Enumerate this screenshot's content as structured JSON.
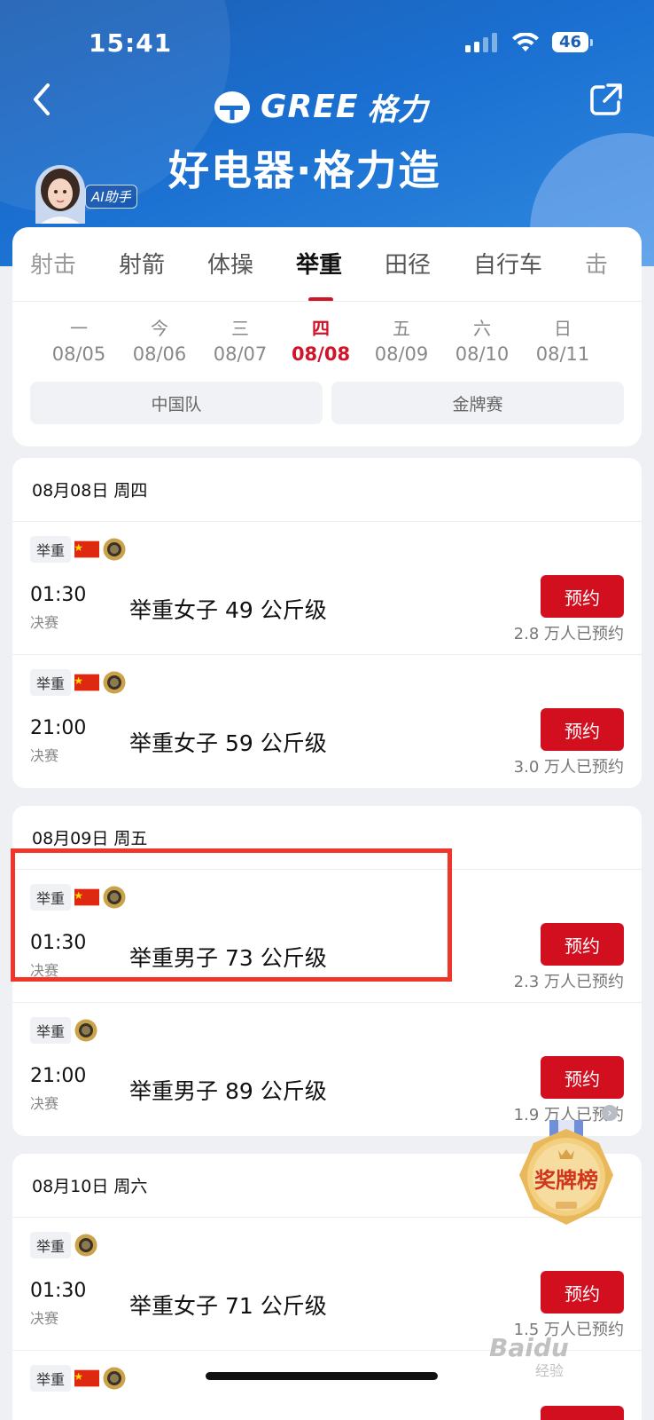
{
  "status_bar": {
    "time": "15:41",
    "battery": "46"
  },
  "header": {
    "brand_name": "GREE",
    "brand_cn": "格力",
    "slogan": "好电器·格力造",
    "ai_badge": "AI助手"
  },
  "sport_tabs": [
    {
      "label": "射击",
      "active": false
    },
    {
      "label": "射箭",
      "active": false
    },
    {
      "label": "体操",
      "active": false
    },
    {
      "label": "举重",
      "active": true
    },
    {
      "label": "田径",
      "active": false
    },
    {
      "label": "自行车",
      "active": false
    },
    {
      "label": "击",
      "active": false
    }
  ],
  "days": [
    {
      "weekday": "一",
      "date": "08/05",
      "active": false
    },
    {
      "weekday": "今",
      "date": "08/06",
      "active": false
    },
    {
      "weekday": "三",
      "date": "08/07",
      "active": false
    },
    {
      "weekday": "四",
      "date": "08/08",
      "active": true
    },
    {
      "weekday": "五",
      "date": "08/09",
      "active": false
    },
    {
      "weekday": "六",
      "date": "08/10",
      "active": false
    },
    {
      "weekday": "日",
      "date": "08/11",
      "active": false
    }
  ],
  "filters": {
    "team": "中国队",
    "gold": "金牌赛"
  },
  "groups": [
    {
      "date": "08月08日 周四",
      "events": [
        {
          "tag": "举重",
          "cn_flag": true,
          "time": "01:30",
          "phase": "决赛",
          "name": "举重女子 49 公斤级",
          "button": "预约",
          "count": "2.8 万人已预约"
        },
        {
          "tag": "举重",
          "cn_flag": true,
          "time": "21:00",
          "phase": "决赛",
          "name": "举重女子 59 公斤级",
          "button": "预约",
          "count": "3.0 万人已预约"
        }
      ]
    },
    {
      "date": "08月09日 周五",
      "events": [
        {
          "tag": "举重",
          "cn_flag": true,
          "time": "01:30",
          "phase": "决赛",
          "name": "举重男子 73 公斤级",
          "button": "预约",
          "count": "2.3 万人已预约"
        },
        {
          "tag": "举重",
          "cn_flag": false,
          "time": "21:00",
          "phase": "决赛",
          "name": "举重男子 89 公斤级",
          "button": "预约",
          "count": "1.9 万人已预约"
        }
      ]
    },
    {
      "date": "08月10日 周六",
      "events": [
        {
          "tag": "举重",
          "cn_flag": false,
          "time": "01:30",
          "phase": "决赛",
          "name": "举重女子 71 公斤级",
          "button": "预约",
          "count": "1.5 万人已预约"
        },
        {
          "tag": "举重",
          "cn_flag": true,
          "time": "",
          "phase": "",
          "name": "",
          "button": "",
          "count": ""
        }
      ]
    }
  ],
  "medal_table": {
    "label": "奖牌榜"
  },
  "watermark": {
    "brand": "Baidu",
    "sub": "经验"
  },
  "colors": {
    "accent_red": "#d20f1f",
    "header_blue": "#1a6fd0",
    "highlight": "#f0362b"
  },
  "icons": [
    "back-icon",
    "share-icon",
    "signal-icon",
    "wifi-icon",
    "battery-icon",
    "china-flag-icon",
    "gold-medal-icon",
    "medal-table-icon"
  ]
}
